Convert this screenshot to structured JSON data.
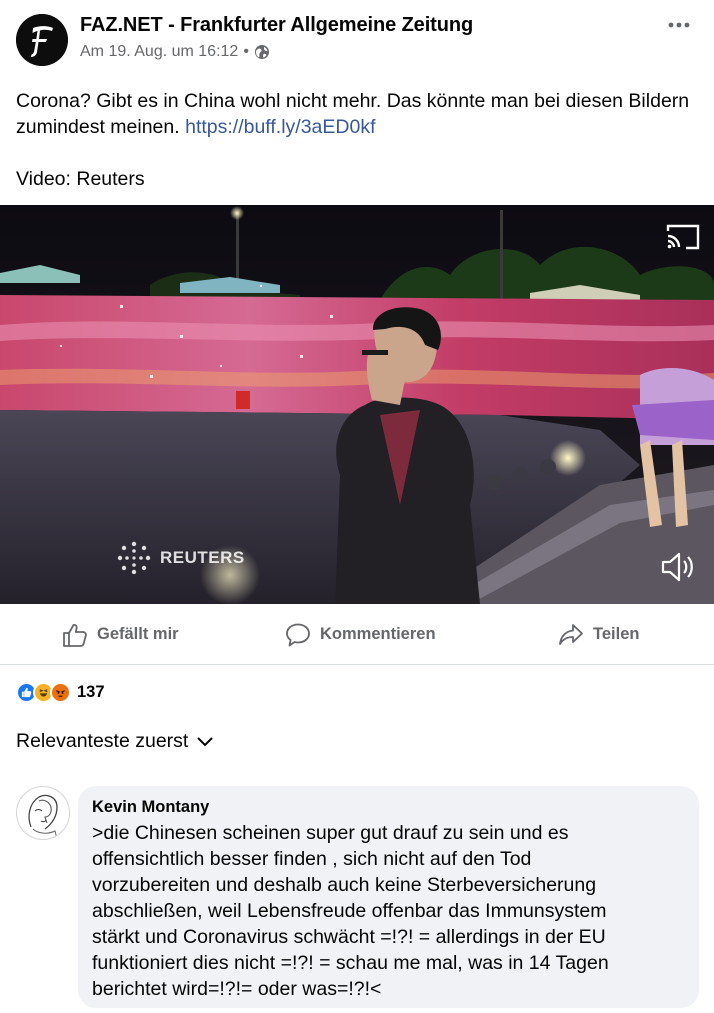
{
  "post": {
    "page_name": "FAZ.NET - Frankfurter Allgemeine Zeitung",
    "timestamp": "Am 19. Aug. um 16:12",
    "separator": "•",
    "privacy_icon": "globe-icon",
    "text": "Corona? Gibt es in China wohl nicht mehr. Das könnte man bei diesen Bildern zumindest meinen.",
    "link": "https://buff.ly/3aED0kf",
    "credit": "Video: Reuters",
    "avatar_letter": "F"
  },
  "video": {
    "watermark": "REUTERS",
    "cast_icon": "cast-icon",
    "volume_icon": "volume-icon"
  },
  "actions": {
    "like_label": "Gefällt mir",
    "comment_label": "Kommentieren",
    "share_label": "Teilen"
  },
  "reactions": {
    "types": [
      "like",
      "haha",
      "angry"
    ],
    "count": "137"
  },
  "sort": {
    "label": "Relevanteste zuerst"
  },
  "comment": {
    "author": "Kevin Montany",
    "text": ">die Chinesen scheinen super  gut drauf zu sein und es\noffensichtlich besser finden , sich nicht auf den Tod\nvorzubereiten und deshalb auch keine Sterbeversicherung\nabschließen, weil  Lebensfreude offenbar das Immunsystem\nstärkt und Coronavirus schwächt  =!?! = allerdings in der EU\nfunktioniert dies nicht =!?! = schau me mal, was in 14 Tagen\nberichtet wird=!?!= oder was=!?!<"
  },
  "colors": {
    "link": "#385898",
    "secondary_text": "#65676b",
    "bubble": "#f0f2f5",
    "like_blue": "#1877f2",
    "haha_yellow": "#f7b125",
    "angry_orange": "#e9710f"
  }
}
